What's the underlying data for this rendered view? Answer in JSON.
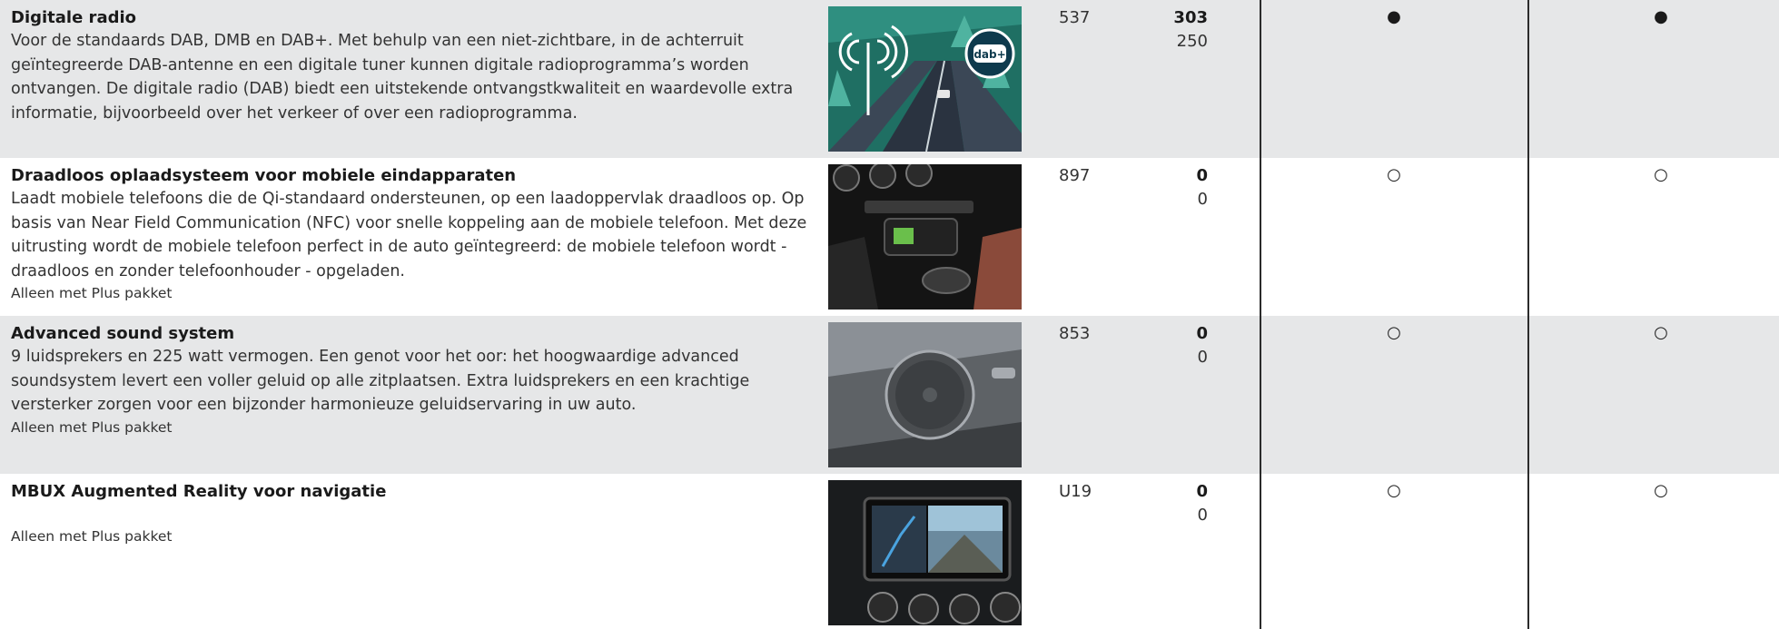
{
  "rows": [
    {
      "title": "Digitale radio",
      "description": "Voor de standaards DAB, DMB en DAB+. Met behulp van een niet-zichtbare, in de achterruit geïntegreerde DAB-antenne en een digitale tuner kunnen digitale radioprogramma’s worden ontvangen. De digitale radio (DAB) biedt een uitstekende ontvangstkwaliteit en waardevolle extra informatie, bijvoorbeeld over het verkeer of over een radioprogramma.",
      "note": "",
      "image_badge": "dab+",
      "code": "537",
      "price_1": "303",
      "price_2": "250",
      "mark_1": "●",
      "mark_2": "●"
    },
    {
      "title": "Draadloos oplaadsysteem voor mobiele eindapparaten",
      "description": "Laadt mobiele telefoons die de Qi-standaard ondersteunen, op een laadoppervlak draadloos op. Op basis van Near Field Communication (NFC) voor snelle koppeling aan de mobiele telefoon. Met deze uitrusting wordt de mobiele telefoon perfect in de auto geïntegreerd: de mobiele telefoon wordt - draadloos en zonder telefoonhouder - opgeladen.",
      "note": "Alleen met Plus pakket",
      "code": "897",
      "price_1": "0",
      "price_2": "0",
      "mark_1": "○",
      "mark_2": "○"
    },
    {
      "title": "Advanced sound system",
      "description": "9 luidsprekers en 225 watt vermogen. Een genot voor het oor: het hoogwaardige advanced soundsystem levert een voller geluid op alle zitplaatsen. Extra luidsprekers en een krachtige versterker zorgen voor een bijzonder harmonieuze geluidservaring in uw auto.",
      "note": "Alleen met Plus pakket",
      "code": "853",
      "price_1": "0",
      "price_2": "0",
      "mark_1": "○",
      "mark_2": "○"
    },
    {
      "title": "MBUX Augmented Reality voor navigatie",
      "description": "",
      "note": "Alleen met Plus pakket",
      "code": "U19",
      "price_1": "0",
      "price_2": "0",
      "mark_1": "○",
      "mark_2": "○"
    }
  ],
  "colors": {
    "row_shade": "#e6e7e8",
    "divider": "#2b2b2b",
    "text": "#222222"
  }
}
